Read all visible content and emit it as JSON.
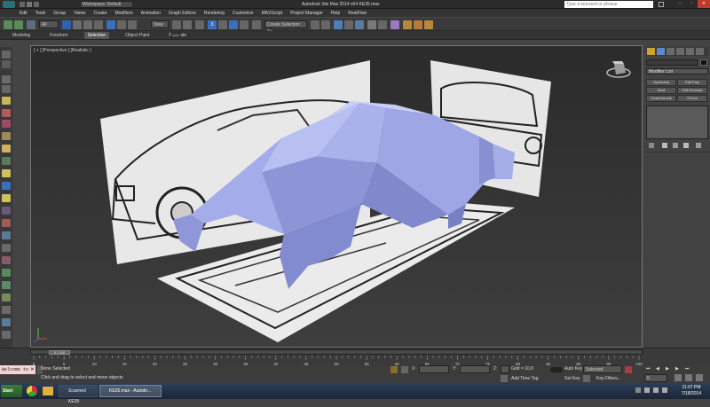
{
  "title_bar": {
    "workspace": "Workspace: Default",
    "title": "Autodesk 3ds Max  2014 x64     KE35.max",
    "search_placeholder": "Type a keyword or phrase"
  },
  "menu": [
    "Edit",
    "Tools",
    "Group",
    "Views",
    "Create",
    "Modifiers",
    "Animation",
    "Graph Editors",
    "Rendering",
    "Customize",
    "MAXScript",
    "Project Manager",
    "Help",
    "RealFlow"
  ],
  "toolbar": {
    "filter": "All",
    "view": "View",
    "count": "3",
    "selection_set": "Create Selection Se"
  },
  "ribbon_tabs": [
    "Modeling",
    "Freeform",
    "Selection",
    "Object Paint",
    "Populate"
  ],
  "viewport": {
    "label": "[ + ] [Perspective ] [Realistic ]"
  },
  "command_panel": {
    "modifier_list": "Modifier List",
    "buttons": [
      "Symmetry",
      "Edit Poly",
      "Shell",
      "Edit Normals",
      "TurboSmooth",
      "XForm"
    ]
  },
  "timeline": {
    "slider": "0 / 100",
    "ticks": [
      "0",
      "5",
      "10",
      "15",
      "20",
      "25",
      "30",
      "35",
      "40",
      "45",
      "50",
      "55",
      "60",
      "65",
      "70",
      "75",
      "80",
      "85",
      "90",
      "95",
      "100"
    ]
  },
  "status": {
    "selection": "None Selected",
    "prompt": "Click and drag to select and move objects",
    "welcome": "Welcome to M",
    "x_label": "X:",
    "y_label": "Y:",
    "z_label": "Z:",
    "grid": "Grid = 10,0",
    "add_time_tag": "Add Time Tag",
    "auto_key": "Auto Key",
    "set_key": "Set Key",
    "key_mode": "Selected",
    "key_filters": "Key Filters...",
    "frame": "0"
  },
  "taskbar": {
    "start": "Start",
    "items": [
      "Scanned KE35",
      "KE35.max - Autode..."
    ],
    "time": "11:07 PM",
    "date": "7/18/2014"
  },
  "colors": {
    "accent": "#1a66c9",
    "car_body": "#9aa2e0",
    "viewport_bg": "#2f2f2f"
  }
}
